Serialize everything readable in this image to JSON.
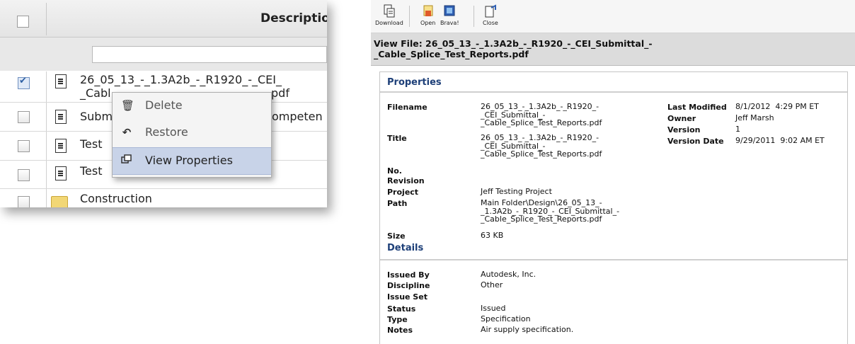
{
  "left_panel": {
    "header_title": "Descriptio",
    "filter_placeholder": "",
    "rows": [
      {
        "name": "26_05_13_-_1.3A2b_-_R1920_-_CEI_",
        "name2": "_Cabl",
        "name2_tail": "pdf",
        "checked": true
      },
      {
        "name": "Subm",
        "name_tail": "ompeten",
        "checked": false
      },
      {
        "name": "Test",
        "checked": false
      },
      {
        "name": "Test",
        "checked": false
      },
      {
        "name": "Construction",
        "checked": false,
        "folder": true
      }
    ],
    "context_menu": [
      {
        "label": "Delete",
        "icon": "trash-icon"
      },
      {
        "label": "Restore",
        "icon": "undo-arrow-icon"
      },
      {
        "label": "View Properties",
        "icon": "properties-window-icon",
        "highlighted": true
      }
    ]
  },
  "toolbar": {
    "download": "Download",
    "open": "Open",
    "brava": "Brava!",
    "close": "Close"
  },
  "view_file_title": "View File: 26_05_13_-_1.3A2b_-_R1920_-_CEI_Submittal_-_Cable_Splice_Test_Reports.pdf",
  "properties": {
    "section_title": "Properties",
    "filename_label": "Filename",
    "filename_value": "26_05_13_-_1.3A2b_-_R1920_-\n_CEI_Submittal_-\n_Cable_Splice_Test_Reports.pdf",
    "title_label": "Title",
    "title_value": "26_05_13_-_1.3A2b_-_R1920_-\n_CEI_Submittal_-\n_Cable_Splice_Test_Reports.pdf",
    "no_label": "No.",
    "revision_label": "Revision",
    "project_label": "Project",
    "project_value": "Jeff Testing Project",
    "path_label": "Path",
    "path_value": "Main Folder\\Design\\26_05_13_-\n_1.3A2b_-_R1920_-_CEI_Submittal_-\n_Cable_Splice_Test_Reports.pdf",
    "size_label": "Size",
    "size_value": "63 KB",
    "last_modified_label": "Last Modified",
    "last_modified_value": "8/1/2012  4:29 PM ET",
    "owner_label": "Owner",
    "owner_value": "Jeff Marsh",
    "version_label": "Version",
    "version_value": "1",
    "version_date_label": "Version Date",
    "version_date_value": "9/29/2011  9:02 AM ET"
  },
  "details": {
    "section_title": "Details",
    "issued_by_label": "Issued By",
    "issued_by_value": "Autodesk, Inc.",
    "discipline_label": "Discipline",
    "discipline_value": "Other",
    "issue_set_label": "Issue Set",
    "status_label": "Status",
    "status_value": "Issued",
    "type_label": "Type",
    "type_value": "Specification",
    "notes_label": "Notes",
    "notes_value": "Air supply specification."
  }
}
